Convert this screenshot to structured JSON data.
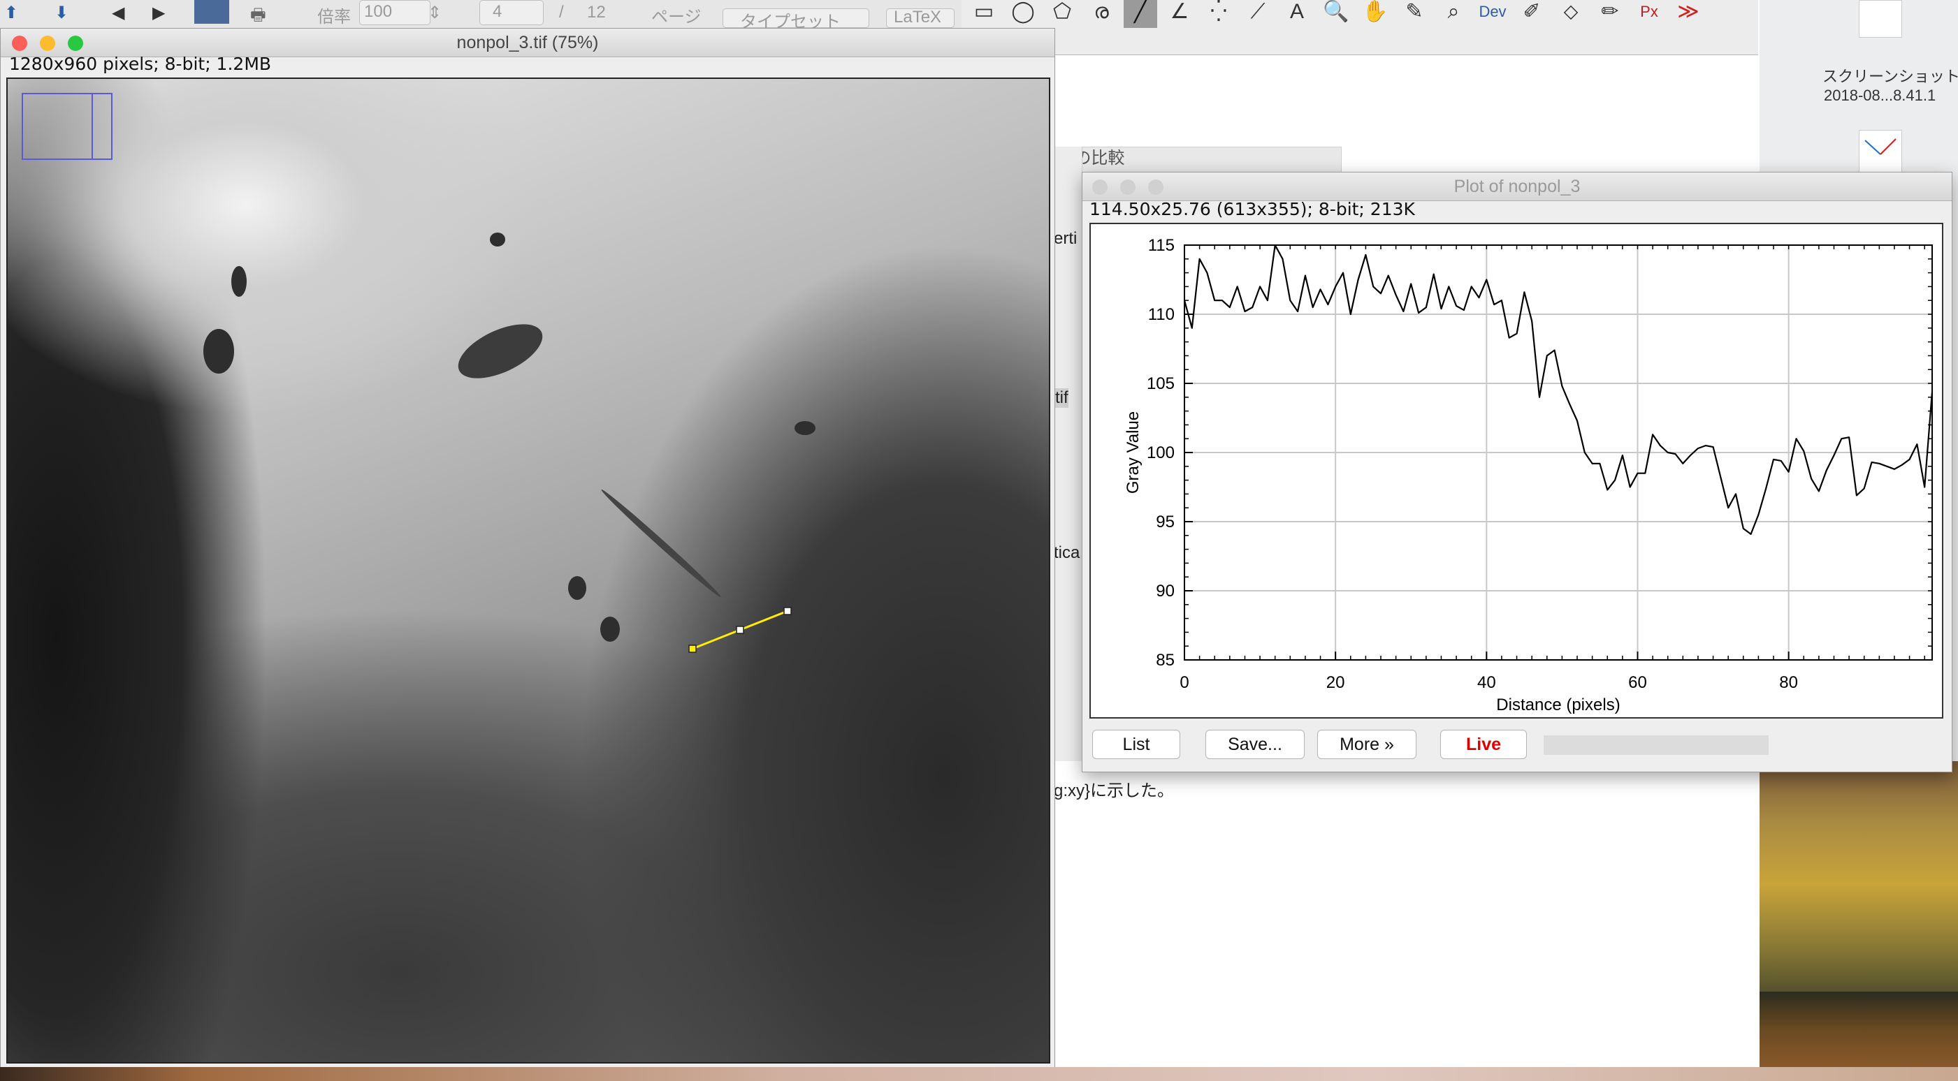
{
  "background_app": {
    "toolbar": {
      "zoom_label": "倍率",
      "zoom_value": "100",
      "page_value": "4",
      "page_total": "12",
      "page_label": "ページ",
      "typeset_button": "タイプセット",
      "latex_selector": "LaTeX"
    },
    "fragments": {
      "comparison": "[S]の比較",
      "vertical_1": "erti",
      "tif": "tif",
      "vertical_2": "tica",
      "caption": "g:xy}に示した。"
    }
  },
  "desktop": {
    "file1_name": "スクリーンショット",
    "file1_date": "2018-08...8.41.1"
  },
  "imagej_toolbar": {
    "tools": [
      {
        "name": "rectangle-tool-icon",
        "glyph": "▭"
      },
      {
        "name": "oval-tool-icon",
        "glyph": "◯"
      },
      {
        "name": "polygon-tool-icon",
        "glyph": "⬠"
      },
      {
        "name": "freehand-tool-icon",
        "glyph": "ര"
      },
      {
        "name": "line-tool-icon",
        "glyph": "╱"
      },
      {
        "name": "angle-tool-icon",
        "glyph": "∠"
      },
      {
        "name": "multipoint-tool-icon",
        "glyph": "⁛"
      },
      {
        "name": "wand-tool-icon",
        "glyph": "⟋"
      },
      {
        "name": "text-tool-icon",
        "glyph": "A"
      },
      {
        "name": "magnifier-tool-icon",
        "glyph": "🔍"
      },
      {
        "name": "hand-tool-icon",
        "glyph": "✋"
      },
      {
        "name": "dropper-tool-icon",
        "glyph": "✎"
      },
      {
        "name": "search-tool-icon",
        "glyph": "⌕"
      },
      {
        "name": "dev-tool-icon",
        "glyph": "Dev"
      },
      {
        "name": "brush-tool-icon",
        "glyph": "✐"
      },
      {
        "name": "flood-fill-tool-icon",
        "glyph": "⬦"
      },
      {
        "name": "pencil-tool-icon",
        "glyph": "✏"
      },
      {
        "name": "pixel-inspector-tool-icon",
        "glyph": "Px"
      },
      {
        "name": "more-tools-icon",
        "glyph": "≫"
      }
    ],
    "selected_tool": "line-tool-icon"
  },
  "image_window": {
    "title": "nonpol_3.tif (75%)",
    "info": "1280x960 pixels; 8-bit; 1.2MB"
  },
  "plot_window": {
    "title": "Plot of nonpol_3",
    "info": "114.50x25.76   (613x355); 8-bit; 213K",
    "buttons": {
      "list": "List",
      "save": "Save...",
      "more": "More »",
      "live": "Live"
    }
  },
  "chart_data": {
    "type": "line",
    "title": "",
    "xlabel": "Distance (pixels)",
    "ylabel": "Gray Value",
    "xlim": [
      0,
      99
    ],
    "ylim": [
      85,
      115
    ],
    "xticks": [
      0,
      20,
      40,
      60,
      80
    ],
    "yticks": [
      85,
      90,
      95,
      100,
      105,
      110,
      115
    ],
    "grid": true,
    "legend": "none",
    "line_color": "#000000",
    "x": [
      0,
      1,
      2,
      3,
      4,
      5,
      6,
      7,
      8,
      9,
      10,
      11,
      12,
      13,
      14,
      15,
      16,
      17,
      18,
      19,
      20,
      21,
      22,
      23,
      24,
      25,
      26,
      27,
      28,
      29,
      30,
      31,
      32,
      33,
      34,
      35,
      36,
      37,
      38,
      39,
      40,
      41,
      42,
      43,
      44,
      45,
      46,
      47,
      48,
      49,
      50,
      51,
      52,
      53,
      54,
      55,
      56,
      57,
      58,
      59,
      60,
      61,
      62,
      63,
      64,
      65,
      66,
      67,
      68,
      69,
      70,
      71,
      72,
      73,
      74,
      75,
      76,
      77,
      78,
      79,
      80,
      81,
      82,
      83,
      84,
      85,
      86,
      87,
      88,
      89,
      90,
      91,
      92,
      93,
      94,
      95,
      96,
      97,
      98,
      99
    ],
    "y": [
      111.0,
      109.0,
      114.0,
      113.0,
      111.0,
      111.0,
      110.5,
      112.0,
      110.2,
      110.5,
      112.0,
      111.0,
      115.0,
      114.0,
      111.0,
      110.2,
      112.8,
      110.5,
      111.8,
      110.7,
      112.0,
      113.0,
      110.0,
      112.5,
      114.3,
      112.0,
      111.5,
      112.8,
      111.4,
      110.2,
      112.2,
      110.1,
      110.5,
      112.9,
      110.4,
      112.0,
      110.6,
      110.3,
      112.0,
      111.2,
      112.5,
      110.7,
      111.0,
      108.3,
      108.6,
      111.6,
      109.5,
      104.0,
      107.0,
      107.4,
      104.8,
      103.5,
      102.3,
      100.0,
      99.2,
      99.2,
      97.3,
      98.0,
      99.8,
      97.5,
      98.5,
      98.5,
      101.3,
      100.5,
      100.0,
      99.9,
      99.2,
      99.8,
      100.3,
      100.5,
      100.4,
      98.2,
      96.0,
      97.0,
      94.5,
      94.1,
      95.5,
      97.4,
      99.5,
      99.4,
      98.6,
      101.0,
      100.1,
      98.1,
      97.2,
      98.7,
      99.8,
      101.0,
      101.1,
      96.9,
      97.4,
      99.3,
      99.2,
      99.0,
      98.8,
      99.1,
      99.5,
      100.6,
      97.5,
      104.4
    ]
  }
}
